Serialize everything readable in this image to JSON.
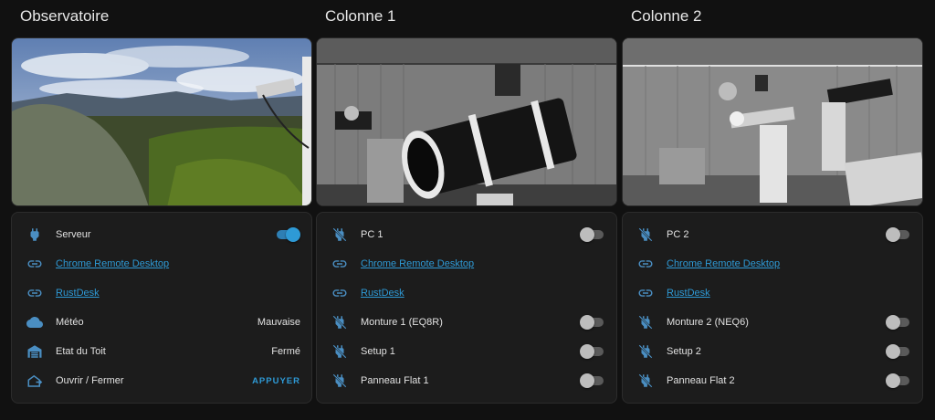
{
  "colors": {
    "accent": "#2e9ad6",
    "icon_blue": "#4a8ec2",
    "off_toggle": "#bdbdbd",
    "card_bg": "#1c1c1c"
  },
  "columns": [
    {
      "title": "Observatoire",
      "camera": "outdoor landscape view",
      "rows": [
        {
          "icon": "power-plug-icon",
          "label": "Serveur",
          "type": "toggle",
          "state": "on"
        },
        {
          "icon": "link-icon",
          "label": "Chrome Remote Desktop",
          "type": "link"
        },
        {
          "icon": "link-icon",
          "label": "RustDesk",
          "type": "link"
        },
        {
          "icon": "cloud-icon",
          "label": "Météo",
          "type": "value",
          "value": "Mauvaise"
        },
        {
          "icon": "garage-icon",
          "label": "Etat du Toit",
          "type": "value",
          "value": "Fermé"
        },
        {
          "icon": "home-export-icon",
          "label": "Ouvrir / Fermer",
          "type": "button",
          "value": "APPUYER"
        }
      ]
    },
    {
      "title": "Colonne 1",
      "camera": "telescope on pier",
      "rows": [
        {
          "icon": "power-plug-off-icon",
          "label": "PC 1",
          "type": "toggle",
          "state": "off"
        },
        {
          "icon": "link-icon",
          "label": "Chrome Remote Desktop",
          "type": "link"
        },
        {
          "icon": "link-icon",
          "label": "RustDesk",
          "type": "link"
        },
        {
          "icon": "power-plug-off-icon",
          "label": "Monture 1 (EQ8R)",
          "type": "toggle",
          "state": "off"
        },
        {
          "icon": "power-plug-off-icon",
          "label": "Setup 1",
          "type": "toggle",
          "state": "off"
        },
        {
          "icon": "power-plug-off-icon",
          "label": "Panneau Flat 1",
          "type": "toggle",
          "state": "off"
        }
      ]
    },
    {
      "title": "Colonne 2",
      "camera": "telescope on pier",
      "rows": [
        {
          "icon": "power-plug-off-icon",
          "label": "PC 2",
          "type": "toggle",
          "state": "off"
        },
        {
          "icon": "link-icon",
          "label": "Chrome Remote Desktop",
          "type": "link"
        },
        {
          "icon": "link-icon",
          "label": "RustDesk",
          "type": "link"
        },
        {
          "icon": "power-plug-off-icon",
          "label": "Monture 2 (NEQ6)",
          "type": "toggle",
          "state": "off"
        },
        {
          "icon": "power-plug-off-icon",
          "label": "Setup 2",
          "type": "toggle",
          "state": "off"
        },
        {
          "icon": "power-plug-off-icon",
          "label": "Panneau Flat 2",
          "type": "toggle",
          "state": "off"
        }
      ]
    }
  ]
}
